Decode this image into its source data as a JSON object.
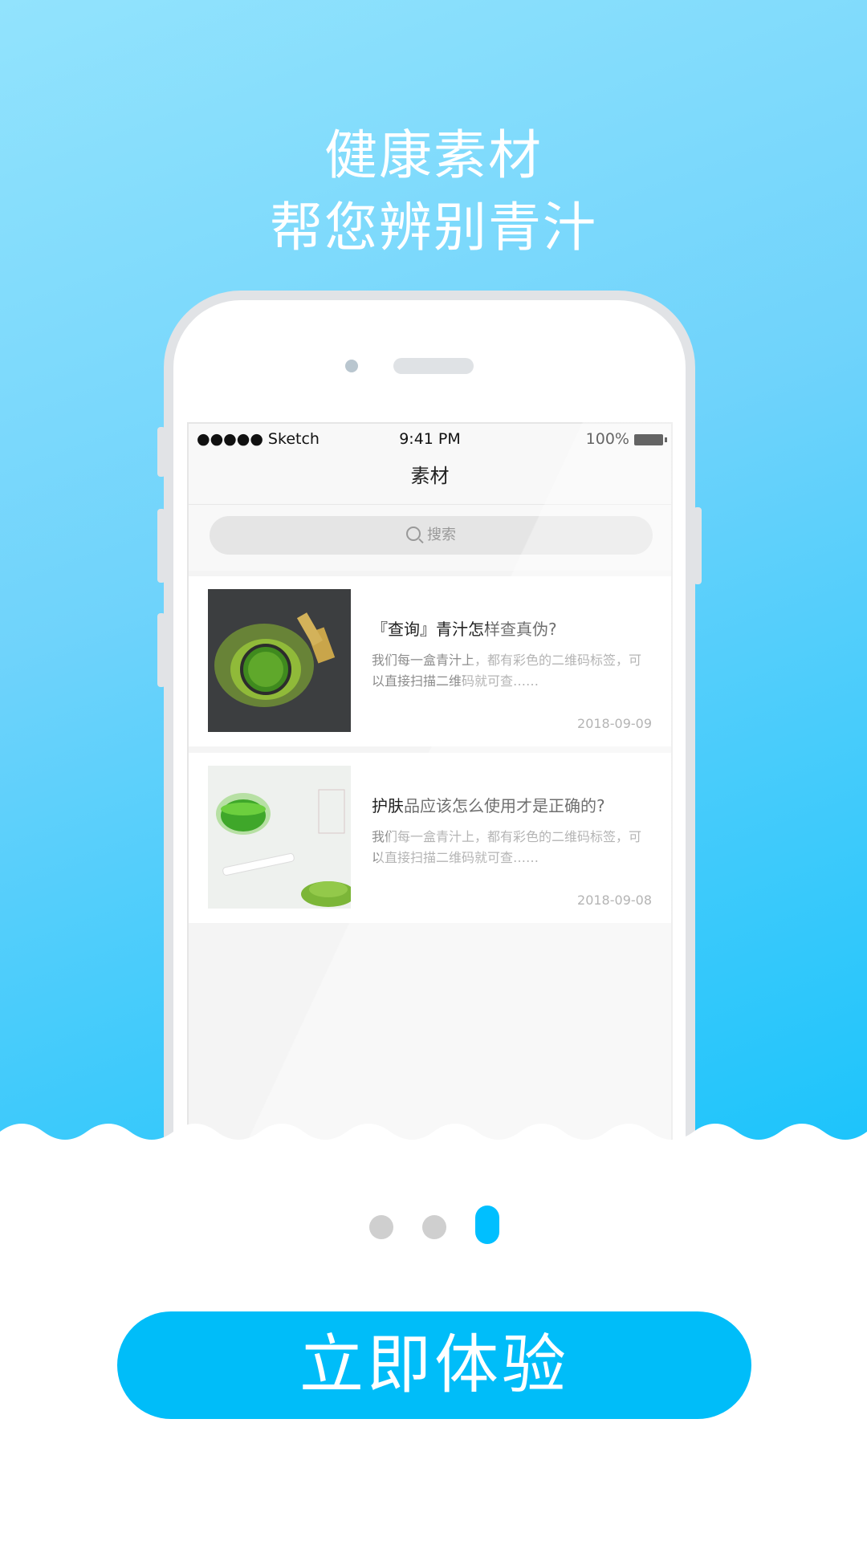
{
  "headline": {
    "line1": "健康素材",
    "line2": "帮您辨别青汁"
  },
  "phone_screen": {
    "status_bar": {
      "carrier": "●●●●● Sketch",
      "time": "9:41 PM",
      "battery": "100%"
    },
    "nav_title": "素材",
    "search_placeholder": "搜索",
    "articles": [
      {
        "title": "『查询』青汁怎样查真伪?",
        "desc": "我们每一盒青汁上，都有彩色的二维码标签，可以直接扫描二维码就可查……",
        "date": "2018-09-09"
      },
      {
        "title": "护肤品应该怎么使用才是正确的?",
        "desc": "我们每一盒青汁上，都有彩色的二维码标签，可以直接扫描二维码就可查……",
        "date": "2018-09-08"
      }
    ]
  },
  "pager": {
    "total": 3,
    "active": 3
  },
  "cta_label": "立即体验",
  "colors": {
    "accent": "#00bdf9",
    "bg_gradient_start": "#92e3fd",
    "bg_gradient_end": "#1dc4fb"
  }
}
